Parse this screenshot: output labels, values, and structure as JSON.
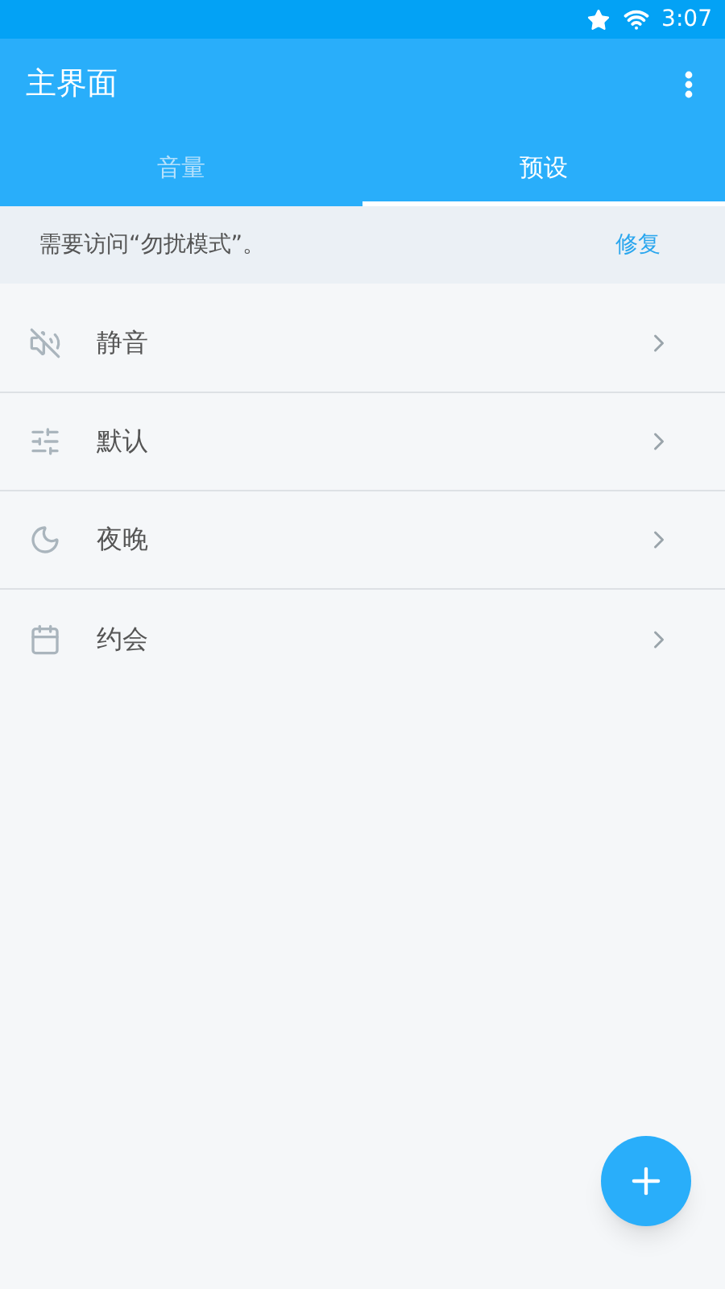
{
  "status_bar": {
    "time": "3:07"
  },
  "app_bar": {
    "title": "主界面"
  },
  "tabs": [
    {
      "label": "音量",
      "selected": false
    },
    {
      "label": "预设",
      "selected": true
    }
  ],
  "banner": {
    "message": "需要访问“勿扰模式”。",
    "action": "修复"
  },
  "presets": [
    {
      "kind": "mute",
      "label": "静音"
    },
    {
      "kind": "sliders",
      "label": "默认"
    },
    {
      "kind": "night",
      "label": "夜晚"
    },
    {
      "kind": "calendar",
      "label": "约会"
    }
  ]
}
